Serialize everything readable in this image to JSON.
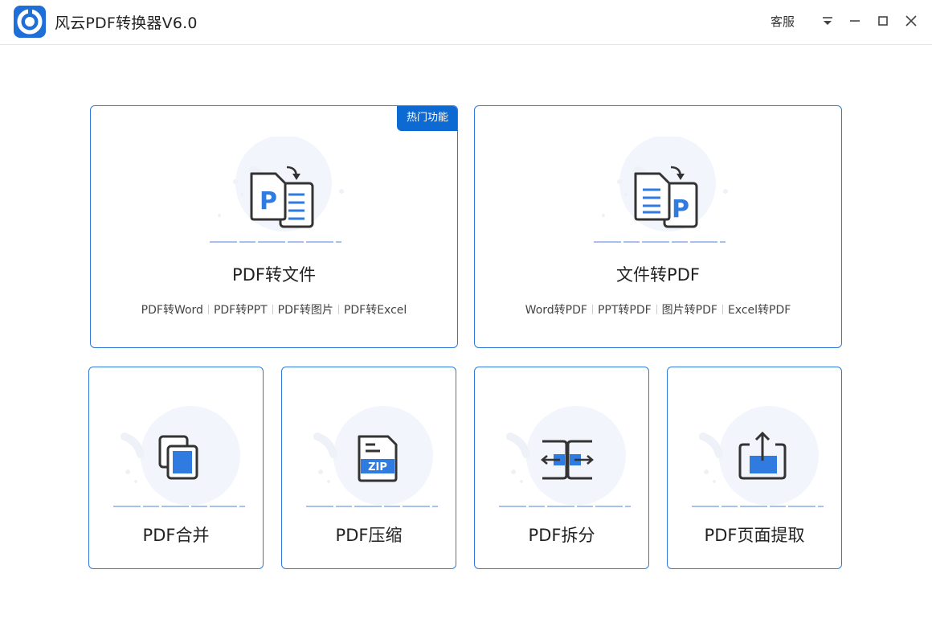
{
  "app": {
    "title": "风云PDF转换器V6.0",
    "customer_service_label": "客服"
  },
  "colors": {
    "accent": "#2f79d8",
    "badge": "#0d6ad2",
    "icon_fill": "#2f7be0",
    "icon_stroke": "#333333",
    "illustration_bg": "#f2f5fc"
  },
  "cards": {
    "pdf_to_file": {
      "title": "PDF转文件",
      "badge": "热门功能",
      "icon": "pdf-to-file-icon",
      "subs": [
        "PDF转Word",
        "PDF转PPT",
        "PDF转图片",
        "PDF转Excel"
      ]
    },
    "file_to_pdf": {
      "title": "文件转PDF",
      "icon": "file-to-pdf-icon",
      "subs": [
        "Word转PDF",
        "PPT转PDF",
        "图片转PDF",
        "Excel转PDF"
      ]
    },
    "merge": {
      "title": "PDF合并",
      "icon": "merge-icon"
    },
    "compress": {
      "title": "PDF压缩",
      "icon": "zip-icon",
      "icon_text": "ZIP"
    },
    "split": {
      "title": "PDF拆分",
      "icon": "split-icon"
    },
    "extract": {
      "title": "PDF页面提取",
      "icon": "extract-icon"
    }
  }
}
